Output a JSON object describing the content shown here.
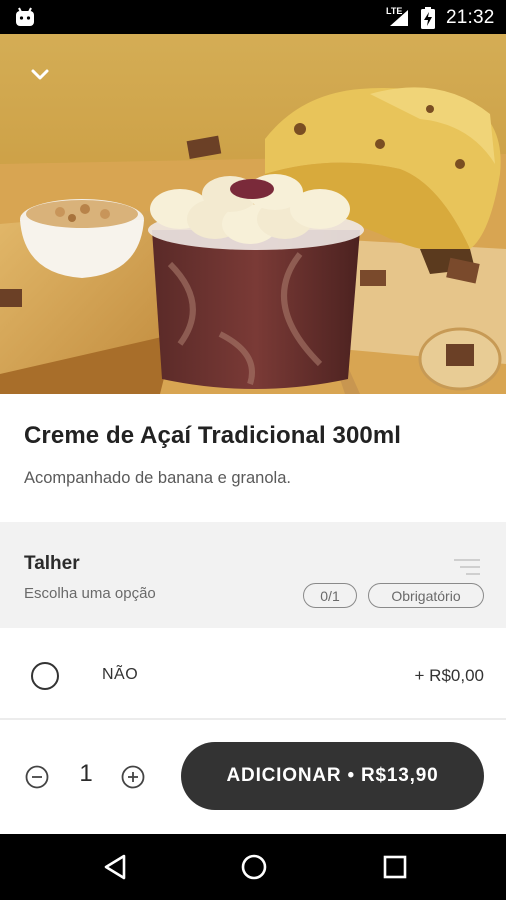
{
  "status_bar": {
    "time": "21:32",
    "network": "LTE",
    "icons": [
      "android-icon",
      "signal-icon",
      "battery-charging-icon"
    ]
  },
  "hero": {
    "collapse_icon": "chevron-down-icon"
  },
  "product": {
    "title": "Creme de Açaí Tradicional 300ml",
    "description": "Acompanhado de banana e granola."
  },
  "option_group": {
    "title": "Talher",
    "subtitle": "Escolha uma opção",
    "count_badge": "0/1",
    "required_badge": "Obrigatório",
    "icon": "filter-icon",
    "options": [
      {
        "label": "NÃO",
        "price": "+ R$0,00",
        "selected": false
      }
    ]
  },
  "cart": {
    "quantity": "1",
    "add_button_label": "ADICIONAR • R$13,90"
  },
  "navigation": {
    "icons": [
      "back-icon",
      "home-icon",
      "recent-apps-icon"
    ]
  },
  "colors": {
    "button_bg": "#333333",
    "group_header_bg": "#f2f2f2",
    "text_primary": "#222222",
    "text_secondary": "#5a5a5a"
  }
}
